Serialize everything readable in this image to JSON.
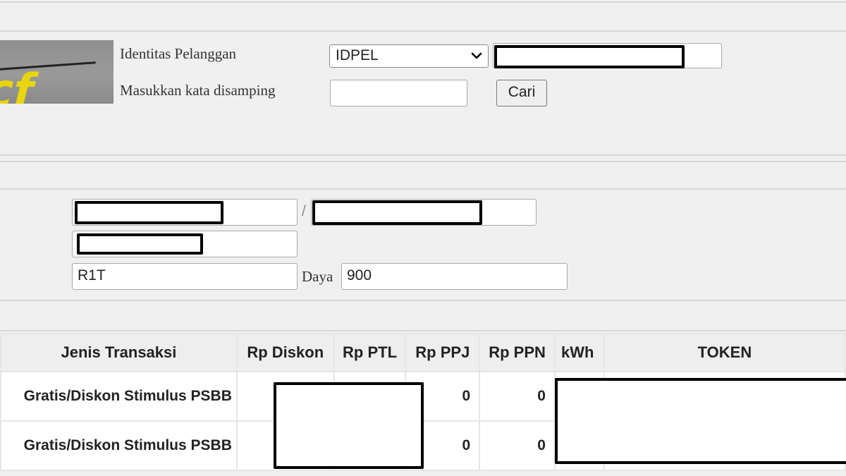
{
  "search": {
    "captcha_text": "cf",
    "id_label": "Identitas Pelanggan",
    "id_type_selected": "IDPEL",
    "captcha_label": "Masukkan kata disamping",
    "captcha_input_value": "",
    "search_button": "Cari"
  },
  "customer": {
    "separator": "/",
    "tarif": "R1T",
    "daya_label": "Daya",
    "daya": "900"
  },
  "table": {
    "columns": [
      "Jenis Transaksi",
      "Rp Diskon",
      "Rp PTL",
      "Rp PPJ",
      "Rp PPN",
      "kWh",
      "TOKEN"
    ],
    "rows": [
      {
        "jenis": "Gratis/Diskon Stimulus PSBB",
        "ppj": "0",
        "ppn": "0"
      },
      {
        "jenis": "Gratis/Diskon Stimulus PSBB",
        "ppj": "0",
        "ppn": "0"
      }
    ]
  },
  "icons": {
    "select_arrow": "chevron-down-icon"
  }
}
